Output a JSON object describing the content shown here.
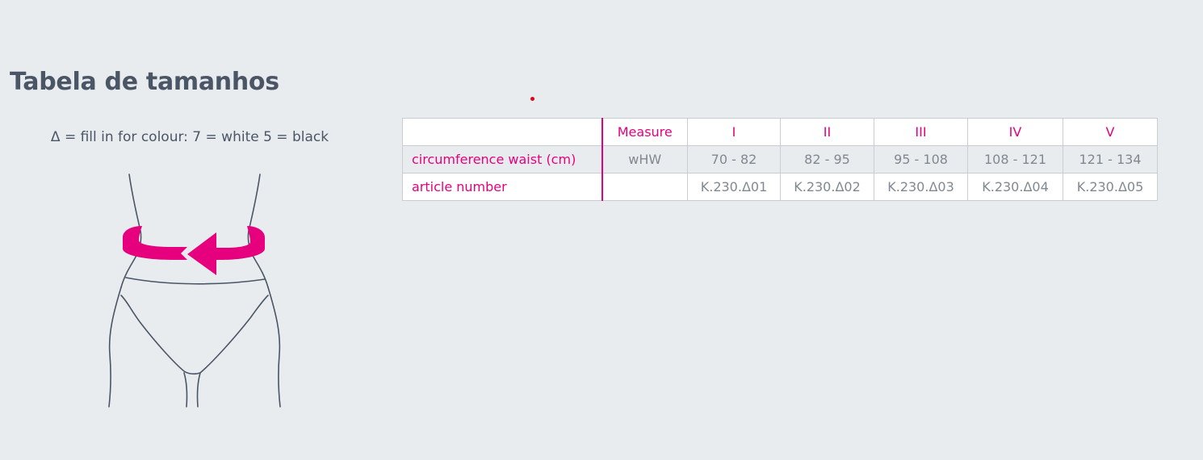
{
  "page": {
    "title": "Tabela de tamanhos",
    "colour_note": "Δ = fill in for colour: 7 = white 5 = black"
  },
  "size_table": {
    "headers": [
      "",
      "Measure",
      "I",
      "II",
      "III",
      "IV",
      "V"
    ],
    "rows": [
      {
        "label": "circumference waist (cm)",
        "measure": "wHW",
        "values": [
          "70 - 82",
          "82 - 95",
          "95 - 108",
          "108 - 121",
          "121 - 134"
        ]
      },
      {
        "label": "article number",
        "measure": "",
        "values": [
          "K.230.Δ01",
          "K.230.Δ02",
          "K.230.Δ03",
          "K.230.Δ04",
          "K.230.Δ05"
        ]
      }
    ]
  },
  "colors": {
    "accent": "#e6007e",
    "text": "#4a5566",
    "background": "#e9ecef",
    "dot": "#e2001a"
  },
  "icons": {
    "measurement_figure": "waist-measurement-illustration",
    "arrow": "circular-arrow-icon"
  }
}
